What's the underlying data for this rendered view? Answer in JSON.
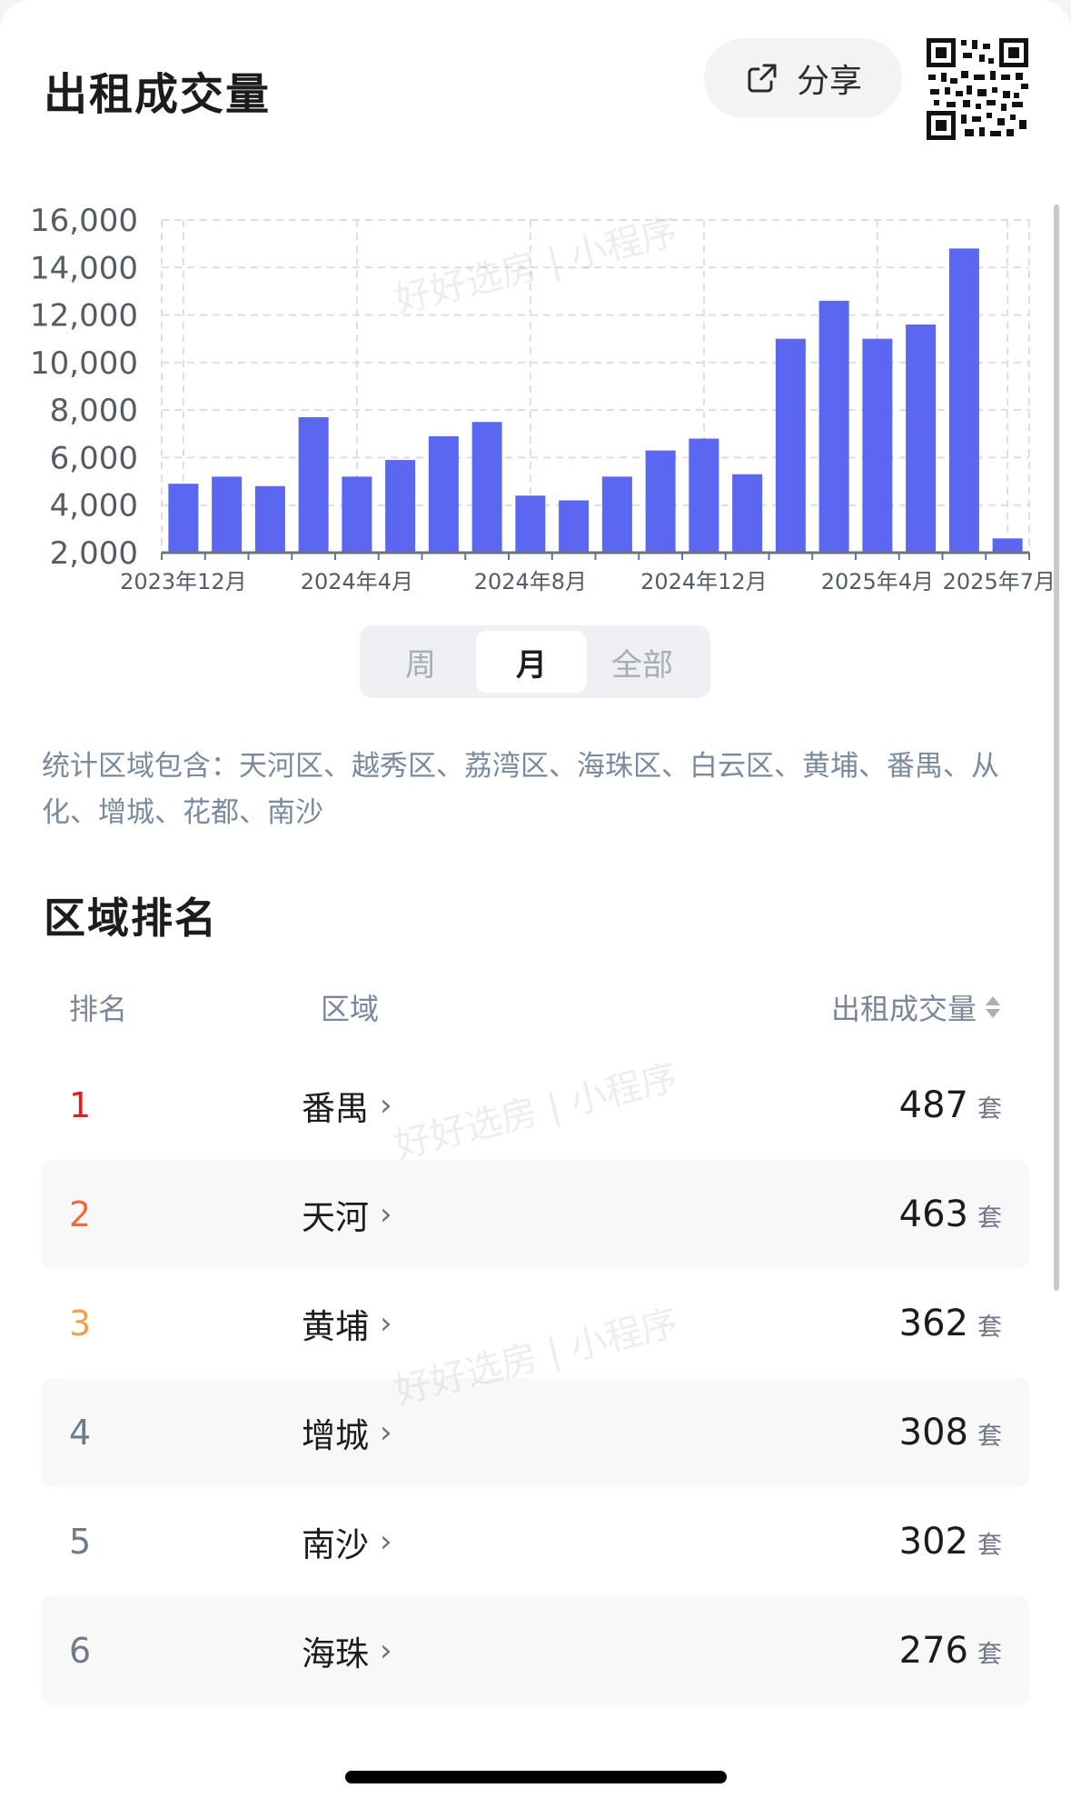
{
  "header": {
    "title": "出租成交量",
    "share_label": "分享"
  },
  "chart_data": {
    "type": "bar",
    "x": [
      "2023-12",
      "2024-01",
      "2024-02",
      "2024-03",
      "2024-04",
      "2024-05",
      "2024-06",
      "2024-07",
      "2024-08",
      "2024-09",
      "2024-10",
      "2024-11",
      "2024-12",
      "2025-01",
      "2025-02",
      "2025-03",
      "2025-04",
      "2025-05",
      "2025-06",
      "2025-07"
    ],
    "values": [
      4900,
      5200,
      4800,
      7700,
      5200,
      5900,
      6900,
      7500,
      4400,
      4200,
      5200,
      6300,
      6800,
      5300,
      11000,
      12600,
      11000,
      11600,
      14800,
      2600
    ],
    "y_ticks": [
      "2,000",
      "4,000",
      "6,000",
      "8,000",
      "10,000",
      "12,000",
      "14,000",
      "16,000"
    ],
    "ylim": [
      2000,
      16000
    ],
    "x_tick_labels": [
      {
        "index": 0,
        "label": "2023年12月"
      },
      {
        "index": 4,
        "label": "2024年4月"
      },
      {
        "index": 8,
        "label": "2024年8月"
      },
      {
        "index": 12,
        "label": "2024年12月"
      },
      {
        "index": 16,
        "label": "2025年4月"
      },
      {
        "index": 19,
        "label": "2025年7月"
      }
    ],
    "bar_color": "#5b67f0",
    "grid": true,
    "grid_style": "dashed"
  },
  "period_tabs": [
    {
      "label": "周",
      "active": false
    },
    {
      "label": "月",
      "active": true
    },
    {
      "label": "全部",
      "active": false
    }
  ],
  "note": "统计区域包含：天河区、越秀区、荔湾区、海珠区、白云区、黄埔、番禺、从化、增城、花都、南沙",
  "ranking": {
    "title": "区域排名",
    "columns": {
      "rank": "排名",
      "area": "区域",
      "volume": "出租成交量"
    },
    "unit": "套",
    "rows": [
      {
        "rank": "1",
        "area": "番禺",
        "volume": "487",
        "rank_color": "#e02020"
      },
      {
        "rank": "2",
        "area": "天河",
        "volume": "463",
        "rank_color": "#f06a3c"
      },
      {
        "rank": "3",
        "area": "黄埔",
        "volume": "362",
        "rank_color": "#f0a04b"
      },
      {
        "rank": "4",
        "area": "增城",
        "volume": "308",
        "rank_color": "#6f7a8c"
      },
      {
        "rank": "5",
        "area": "南沙",
        "volume": "302",
        "rank_color": "#6f7a8c"
      },
      {
        "rank": "6",
        "area": "海珠",
        "volume": "276",
        "rank_color": "#6f7a8c"
      }
    ]
  },
  "watermark": "好好选房 | 小程序"
}
